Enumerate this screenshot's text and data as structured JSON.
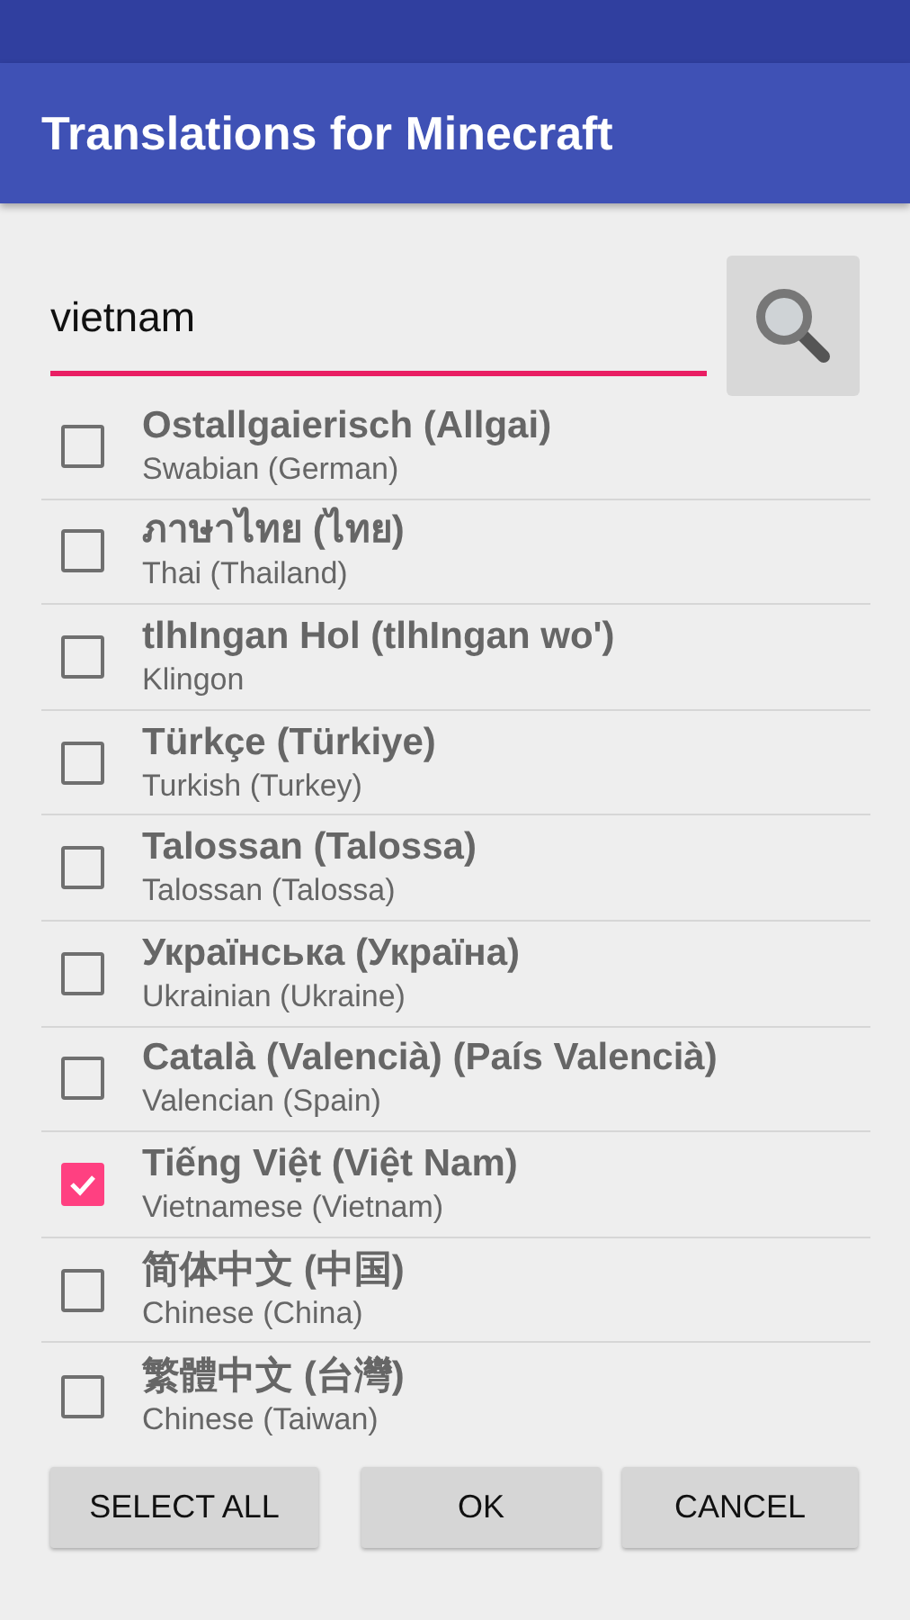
{
  "app_bar": {
    "title": "Translations for Minecraft"
  },
  "search": {
    "value": "vietnam"
  },
  "languages": [
    {
      "name": "Ostallgaierisch (Allgai)",
      "description": "Swabian (German)",
      "checked": false
    },
    {
      "name": "ภาษาไทย (ไทย)",
      "description": "Thai (Thailand)",
      "checked": false
    },
    {
      "name": "tlhIngan Hol (tlhIngan wo')",
      "description": "Klingon",
      "checked": false
    },
    {
      "name": "Türkçe (Türkiye)",
      "description": "Turkish (Turkey)",
      "checked": false
    },
    {
      "name": "Talossan (Talossa)",
      "description": "Talossan (Talossa)",
      "checked": false
    },
    {
      "name": "Українська (Україна)",
      "description": "Ukrainian (Ukraine)",
      "checked": false
    },
    {
      "name": "Català (Valencià) (País Valencià)",
      "description": "Valencian (Spain)",
      "checked": false
    },
    {
      "name": "Tiếng Việt (Việt Nam)",
      "description": "Vietnamese (Vietnam)",
      "checked": true
    },
    {
      "name": "简体中文 (中国)",
      "description": "Chinese (China)",
      "checked": false
    },
    {
      "name": "繁體中文 (台灣)",
      "description": "Chinese (Taiwan)",
      "checked": false
    }
  ],
  "buttons": [
    "SELECT ALL",
    "OK",
    "CANCEL"
  ]
}
